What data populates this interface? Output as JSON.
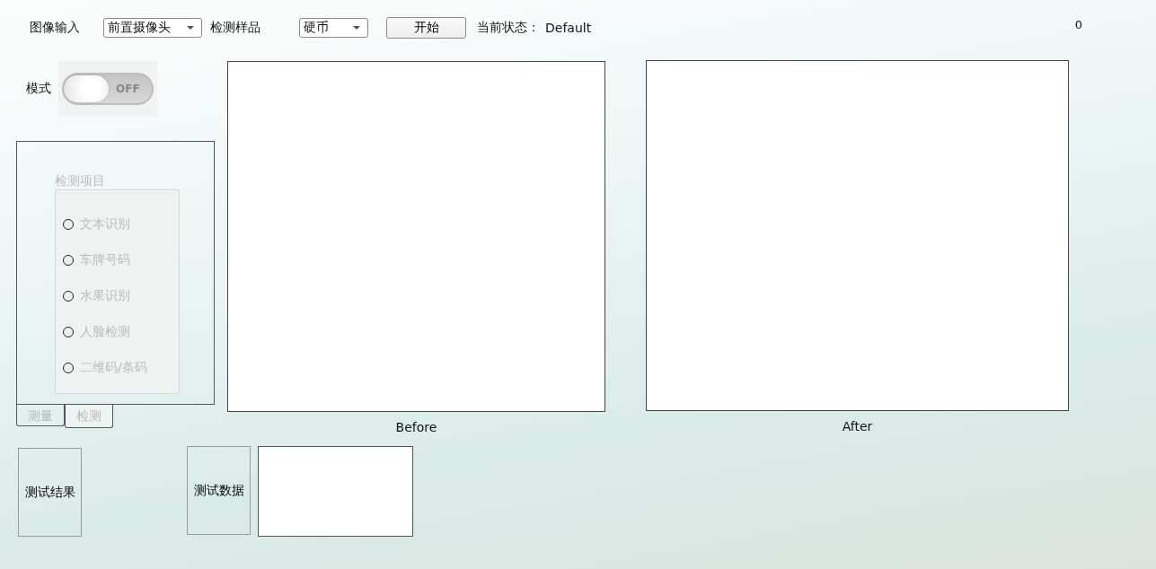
{
  "toolbar": {
    "image_input_label": "图像输入",
    "image_input": {
      "value": "前置摄像头"
    },
    "sample_label": "检测样品",
    "sample": {
      "value": "硬币"
    },
    "start_button": "开始",
    "status_label": "当前状态：",
    "status_value": "Default",
    "counter": "0"
  },
  "mode": {
    "label": "模式",
    "toggle": {
      "on": false,
      "text": "OFF"
    }
  },
  "detect_panel": {
    "title": "检测项目",
    "disabled": true,
    "options": [
      {
        "label": "文本识别",
        "selected": false
      },
      {
        "label": "车牌号码",
        "selected": false
      },
      {
        "label": "水果识别",
        "selected": false
      },
      {
        "label": "人脸检测",
        "selected": false
      },
      {
        "label": "二维码/条码",
        "selected": false
      }
    ]
  },
  "tabs": [
    {
      "label": "测量",
      "selected": false
    },
    {
      "label": "检测",
      "selected": true
    }
  ],
  "views": [
    {
      "caption": "Before"
    },
    {
      "caption": "After"
    }
  ],
  "bottom": {
    "result_button": "测试结果",
    "data_button": "测试数据"
  }
}
